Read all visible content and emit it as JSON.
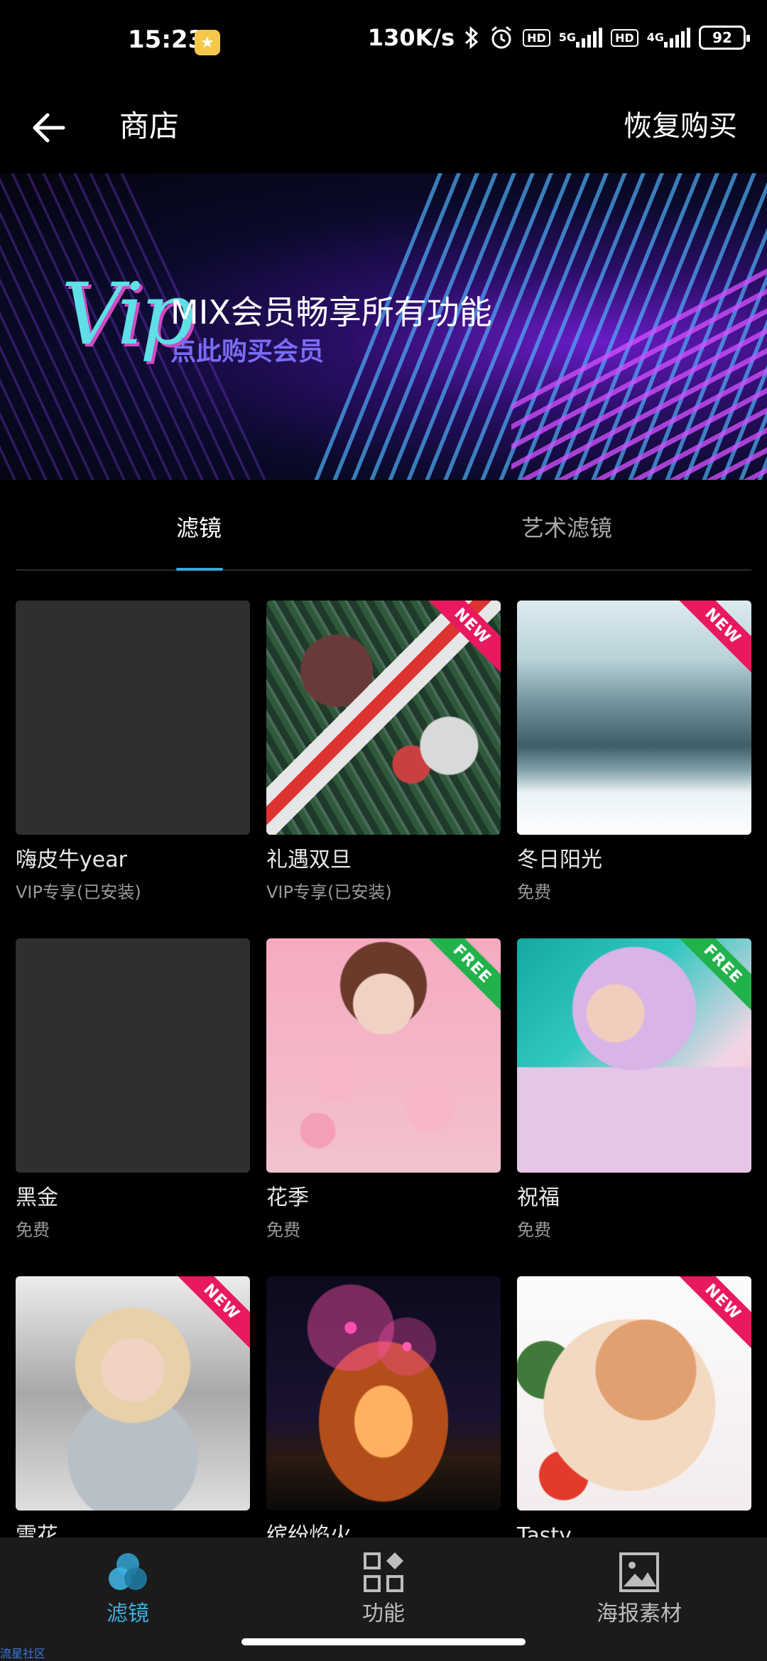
{
  "status_bar": {
    "time": "15:23",
    "net_speed": "130K/s",
    "hd1": "HD",
    "net1": "5G",
    "hd2": "HD",
    "net2": "4G",
    "battery": "92"
  },
  "header": {
    "title": "商店",
    "restore_label": "恢复购买"
  },
  "banner": {
    "logo": "Vip",
    "title": "MIX会员畅享所有功能",
    "subtitle": "点此购买会员"
  },
  "tabs": [
    {
      "label": "滤镜",
      "active": true
    },
    {
      "label": "艺术滤镜",
      "active": false
    }
  ],
  "filters": [
    {
      "name": "嗨皮牛year",
      "sub": "VIP专享(已安装)",
      "badge": ""
    },
    {
      "name": "礼遇双旦",
      "sub": "VIP专享(已安装)",
      "badge": "NEW"
    },
    {
      "name": "冬日阳光",
      "sub": "免费",
      "badge": "NEW"
    },
    {
      "name": "黑金",
      "sub": "免费",
      "badge": ""
    },
    {
      "name": "花季",
      "sub": "免费",
      "badge": "FREE"
    },
    {
      "name": "祝福",
      "sub": "免费",
      "badge": "FREE"
    },
    {
      "name": "雪花",
      "sub": "",
      "badge": "NEW"
    },
    {
      "name": "缤纷焰火",
      "sub": "",
      "badge": ""
    },
    {
      "name": "Tasty",
      "sub": "",
      "badge": "NEW"
    }
  ],
  "bottom_nav": [
    {
      "label": "滤镜",
      "icon": "filter-icon",
      "active": true
    },
    {
      "label": "功能",
      "icon": "grid-icon",
      "active": false
    },
    {
      "label": "海报素材",
      "icon": "image-icon",
      "active": false
    }
  ],
  "watermark": "流星社区",
  "colors": {
    "accent": "#3fb0e0",
    "new_badge": "#e8195f",
    "free_badge": "#22b24c",
    "banner_subtitle": "#7a6cf5"
  }
}
